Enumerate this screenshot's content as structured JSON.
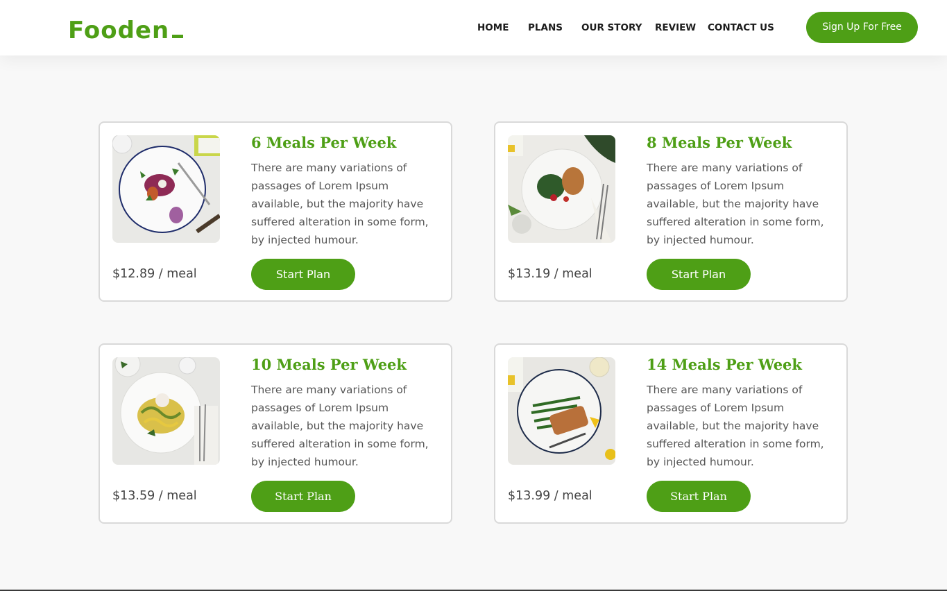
{
  "header": {
    "logo": "Fooden",
    "nav": [
      {
        "label": "HOME"
      },
      {
        "label": "PLANS"
      },
      {
        "label": "OUR STORY"
      },
      {
        "label": "REVIEW"
      },
      {
        "label": "CONTACT US"
      }
    ],
    "cta_label": "Sign Up For Free"
  },
  "plans": [
    {
      "title": "6 Meals Per Week",
      "description": "There are many variations of passages of Lorem Ipsum available, but the majority have suffered alteration in some form, by injected humour.",
      "price": "$12.89 / meal",
      "button_label": "Start Plan",
      "image": "beet-salad-plate-photo"
    },
    {
      "title": "8 Meals Per Week",
      "description": "There are many variations of passages of Lorem Ipsum available, but the majority have suffered alteration in some form, by injected humour.",
      "price": "$13.19 / meal",
      "button_label": "Start Plan",
      "image": "chicken-greens-plate-photo"
    },
    {
      "title": "10 Meals Per Week",
      "description": "There are many variations of passages of Lorem Ipsum available, but the majority have suffered alteration in some form, by injected humour.",
      "price": "$13.59 / meal",
      "button_label": "Start Plan",
      "image": "zucchini-noodles-plate-photo"
    },
    {
      "title": "14 Meals Per Week",
      "description": "There are many variations of passages of Lorem Ipsum available, but the majority have suffered alteration in some form, by injected humour.",
      "price": "$13.99 / meal",
      "button_label": "Start Plan",
      "image": "salmon-green-beans-plate-photo"
    }
  ],
  "colors": {
    "brand": "#4e9f16",
    "page_bg": "#f8f8f8",
    "card_border": "#d9d9d9"
  }
}
